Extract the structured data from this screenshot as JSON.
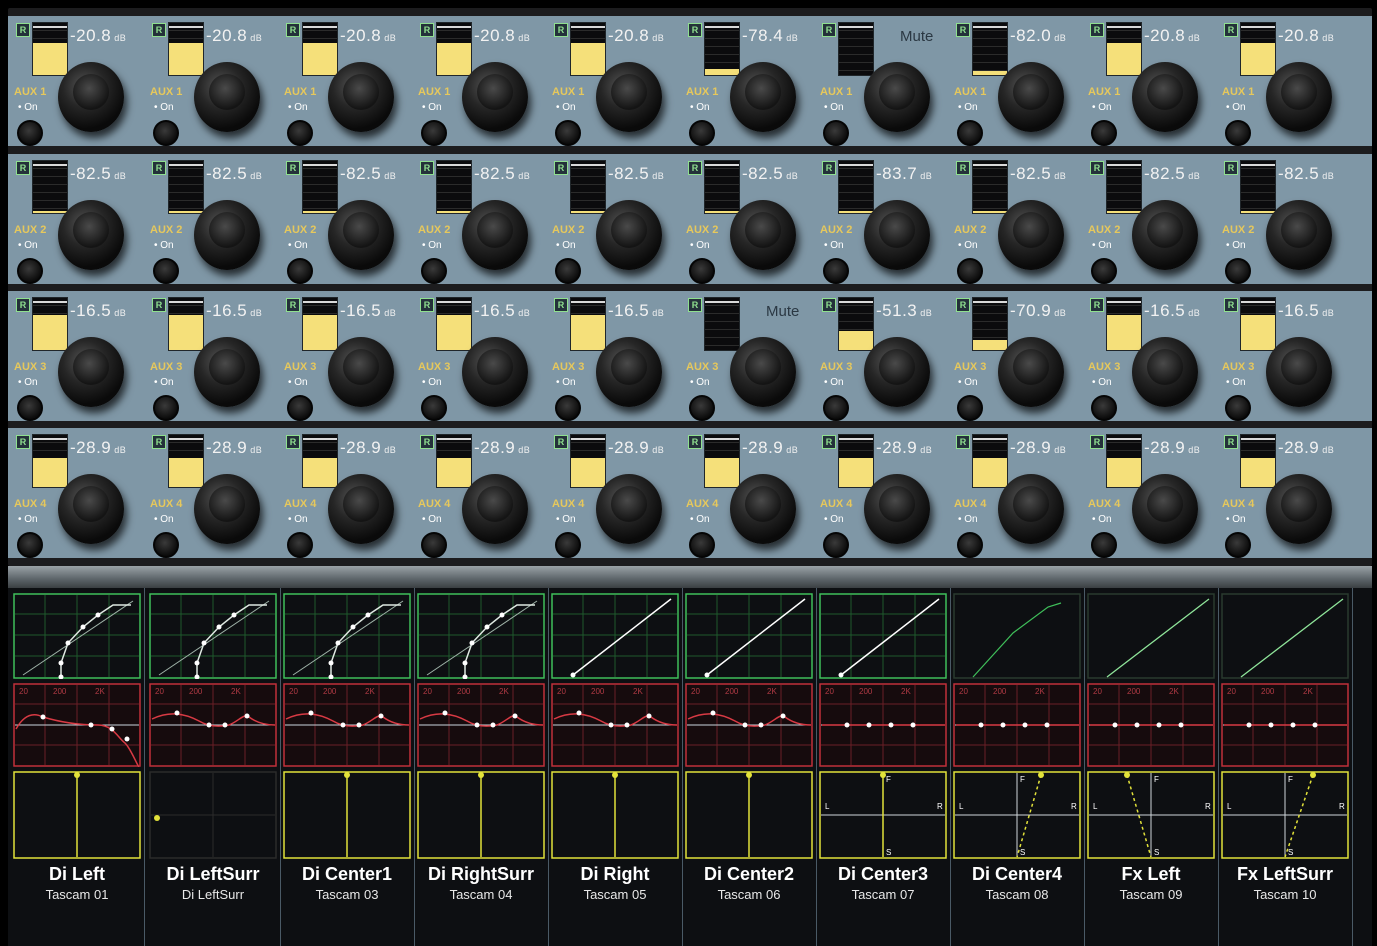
{
  "aux_rows": [
    {
      "label": "AUX 1",
      "on_label": "• On",
      "cells": [
        {
          "value": "-20.8",
          "unit": "dB",
          "level": 0.62,
          "mute": false
        },
        {
          "value": "-20.8",
          "unit": "dB",
          "level": 0.62,
          "mute": false
        },
        {
          "value": "-20.8",
          "unit": "dB",
          "level": 0.62,
          "mute": false
        },
        {
          "value": "-20.8",
          "unit": "dB",
          "level": 0.62,
          "mute": false
        },
        {
          "value": "-20.8",
          "unit": "dB",
          "level": 0.62,
          "mute": false
        },
        {
          "value": "-78.4",
          "unit": "dB",
          "level": 0.12,
          "mute": false
        },
        {
          "value": "",
          "unit": "",
          "level": 0.0,
          "mute": true,
          "mute_label": "Mute"
        },
        {
          "value": "-82.0",
          "unit": "dB",
          "level": 0.08,
          "mute": false
        },
        {
          "value": "-20.8",
          "unit": "dB",
          "level": 0.62,
          "mute": false
        },
        {
          "value": "-20.8",
          "unit": "dB",
          "level": 0.62,
          "mute": false
        }
      ]
    },
    {
      "label": "AUX 2",
      "on_label": "• On",
      "cells": [
        {
          "value": "-82.5",
          "unit": "dB",
          "level": 0.04,
          "mute": false
        },
        {
          "value": "-82.5",
          "unit": "dB",
          "level": 0.04,
          "mute": false
        },
        {
          "value": "-82.5",
          "unit": "dB",
          "level": 0.04,
          "mute": false
        },
        {
          "value": "-82.5",
          "unit": "dB",
          "level": 0.04,
          "mute": false
        },
        {
          "value": "-82.5",
          "unit": "dB",
          "level": 0.04,
          "mute": false
        },
        {
          "value": "-82.5",
          "unit": "dB",
          "level": 0.04,
          "mute": false
        },
        {
          "value": "-83.7",
          "unit": "dB",
          "level": 0.04,
          "mute": false
        },
        {
          "value": "-82.5",
          "unit": "dB",
          "level": 0.04,
          "mute": false
        },
        {
          "value": "-82.5",
          "unit": "dB",
          "level": 0.04,
          "mute": false
        },
        {
          "value": "-82.5",
          "unit": "dB",
          "level": 0.04,
          "mute": false
        }
      ]
    },
    {
      "label": "AUX 3",
      "on_label": "• On",
      "cells": [
        {
          "value": "-16.5",
          "unit": "dB",
          "level": 0.68,
          "mute": false
        },
        {
          "value": "-16.5",
          "unit": "dB",
          "level": 0.68,
          "mute": false
        },
        {
          "value": "-16.5",
          "unit": "dB",
          "level": 0.68,
          "mute": false
        },
        {
          "value": "-16.5",
          "unit": "dB",
          "level": 0.68,
          "mute": false
        },
        {
          "value": "-16.5",
          "unit": "dB",
          "level": 0.68,
          "mute": false
        },
        {
          "value": "",
          "unit": "",
          "level": 0.0,
          "mute": true,
          "mute_label": "Mute"
        },
        {
          "value": "-51.3",
          "unit": "dB",
          "level": 0.36,
          "mute": false
        },
        {
          "value": "-70.9",
          "unit": "dB",
          "level": 0.2,
          "mute": false
        },
        {
          "value": "-16.5",
          "unit": "dB",
          "level": 0.68,
          "mute": false
        },
        {
          "value": "-16.5",
          "unit": "dB",
          "level": 0.68,
          "mute": false
        }
      ]
    },
    {
      "label": "AUX 4",
      "on_label": "• On",
      "cells": [
        {
          "value": "-28.9",
          "unit": "dB",
          "level": 0.55,
          "mute": false
        },
        {
          "value": "-28.9",
          "unit": "dB",
          "level": 0.55,
          "mute": false
        },
        {
          "value": "-28.9",
          "unit": "dB",
          "level": 0.55,
          "mute": false
        },
        {
          "value": "-28.9",
          "unit": "dB",
          "level": 0.55,
          "mute": false
        },
        {
          "value": "-28.9",
          "unit": "dB",
          "level": 0.55,
          "mute": false
        },
        {
          "value": "-28.9",
          "unit": "dB",
          "level": 0.55,
          "mute": false
        },
        {
          "value": "-28.9",
          "unit": "dB",
          "level": 0.55,
          "mute": false
        },
        {
          "value": "-28.9",
          "unit": "dB",
          "level": 0.55,
          "mute": false
        },
        {
          "value": "-28.9",
          "unit": "dB",
          "level": 0.55,
          "mute": false
        },
        {
          "value": "-28.9",
          "unit": "dB",
          "level": 0.55,
          "mute": false
        }
      ]
    }
  ],
  "r_badge": "R",
  "eq_freq_labels": [
    "20",
    "200",
    "2K"
  ],
  "pan_labels": {
    "left": "L",
    "right": "R",
    "front": "F",
    "surround": "S"
  },
  "channels": [
    {
      "name": "Di Left",
      "sub": "Tascam 01",
      "dyn": "comp",
      "eq": "a",
      "pan": "single"
    },
    {
      "name": "Di LeftSurr",
      "sub": "Di LeftSurr",
      "dyn": "comp",
      "eq": "b",
      "pan": "dot"
    },
    {
      "name": "Di Center1",
      "sub": "Tascam 03",
      "dyn": "comp",
      "eq": "b",
      "pan": "single"
    },
    {
      "name": "Di RightSurr",
      "sub": "Tascam 04",
      "dyn": "comp",
      "eq": "b",
      "pan": "single"
    },
    {
      "name": "Di Right",
      "sub": "Tascam 05",
      "dyn": "linear",
      "eq": "b",
      "pan": "single"
    },
    {
      "name": "Di Center2",
      "sub": "Tascam 06",
      "dyn": "linear",
      "eq": "b",
      "pan": "single"
    },
    {
      "name": "Di Center3",
      "sub": "Tascam 07",
      "dyn": "linear",
      "eq": "flat",
      "pan": "cross"
    },
    {
      "name": "Di Center4",
      "sub": "Tascam 08",
      "dyn": "dim",
      "eq": "flat",
      "pan": "diag-r"
    },
    {
      "name": "Fx Left",
      "sub": "Tascam 09",
      "dyn": "bright",
      "eq": "flat",
      "pan": "diag-l"
    },
    {
      "name": "Fx LeftSurr",
      "sub": "Tascam 10",
      "dyn": "bright",
      "eq": "flat",
      "pan": "diag-r2"
    }
  ],
  "colors": {
    "strip_bg": "#7f97a6",
    "meter_fill": "#f5e07a",
    "aux_label": "#e6c85c",
    "dyn_green": "#3fbf5a",
    "eq_red": "#c0303a",
    "pan_yellow": "#e2e23a"
  }
}
